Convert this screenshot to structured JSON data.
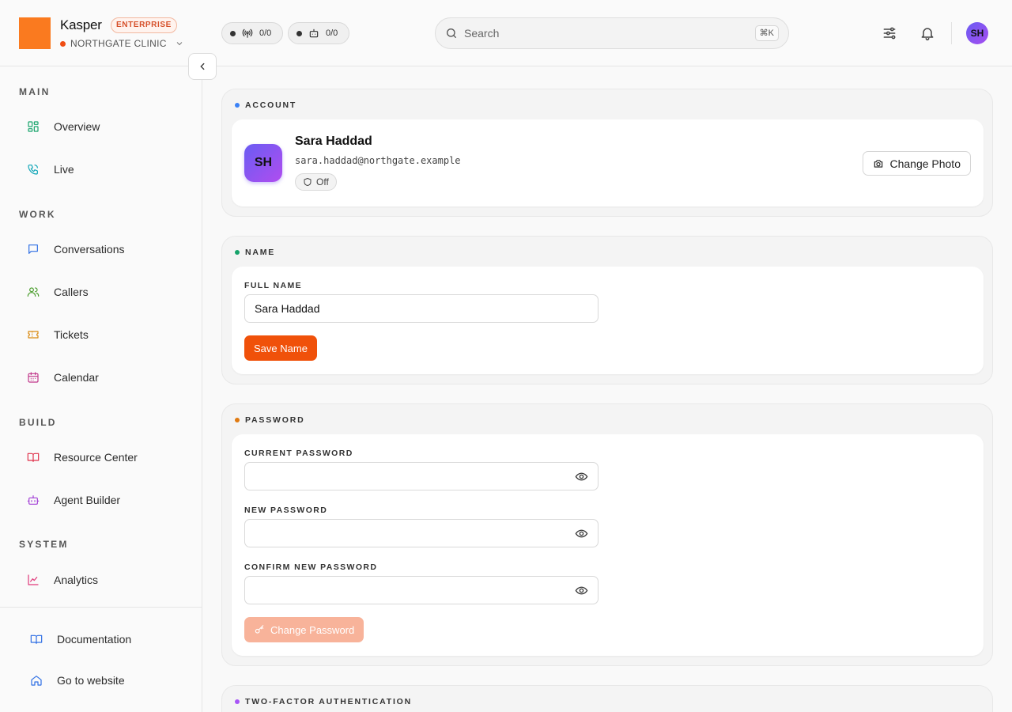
{
  "header": {
    "brand_name": "Kasper",
    "brand_badge": "ENTERPRISE",
    "org_name": "NORTHGATE CLINIC",
    "live_calls_count": "0/0",
    "agents_count": "0/0",
    "search_placeholder": "Search",
    "search_shortcut": "⌘K",
    "avatar_initials": "SH"
  },
  "sidebar": {
    "sections": {
      "main": "MAIN",
      "work": "WORK",
      "build": "BUILD",
      "system": "SYSTEM"
    },
    "items": [
      {
        "label": "Overview",
        "icon": "dashboard-icon",
        "color": "#16a36a"
      },
      {
        "label": "Live",
        "icon": "phone-icon",
        "color": "#0ea5b7"
      },
      {
        "label": "Conversations",
        "icon": "message-icon",
        "color": "#2f6fe4"
      },
      {
        "label": "Callers",
        "icon": "users-icon",
        "color": "#4a9d2c"
      },
      {
        "label": "Tickets",
        "icon": "ticket-icon",
        "color": "#d98a10"
      },
      {
        "label": "Calendar",
        "icon": "calendar-icon",
        "color": "#c0368a"
      },
      {
        "label": "Resource Center",
        "icon": "book-icon",
        "color": "#e0334c"
      },
      {
        "label": "Agent Builder",
        "icon": "bot-icon",
        "color": "#a23fd6"
      },
      {
        "label": "Analytics",
        "icon": "chart-icon",
        "color": "#e0397a"
      }
    ],
    "footer": [
      {
        "label": "Documentation",
        "icon": "book-open-icon",
        "color": "#2f6fe4"
      },
      {
        "label": "Go to website",
        "icon": "home-icon",
        "color": "#2f6fe4"
      }
    ]
  },
  "account": {
    "section_title": "ACCOUNT",
    "accent": "#3b82f6",
    "avatar_initials": "SH",
    "name": "Sara Haddad",
    "email": "sara.haddad@northgate.example",
    "twofa_status": "Off",
    "change_photo_label": "Change Photo"
  },
  "name_section": {
    "section_title": "NAME",
    "accent": "#16a36a",
    "full_name_label": "FULL NAME",
    "full_name_value": "Sara Haddad",
    "save_label": "Save Name"
  },
  "password_section": {
    "section_title": "PASSWORD",
    "accent": "#e07a10",
    "current_label": "CURRENT PASSWORD",
    "new_label": "NEW PASSWORD",
    "confirm_label": "CONFIRM NEW PASSWORD",
    "current_value": "",
    "new_value": "",
    "confirm_value": "",
    "change_label": "Change Password"
  },
  "twofa_section": {
    "section_title": "TWO-FACTOR AUTHENTICATION",
    "accent": "#a855f7"
  },
  "colors": {
    "primary": "#f0510a",
    "primary_disabled": "#f8b39a",
    "logo": "#fa7a1f"
  }
}
